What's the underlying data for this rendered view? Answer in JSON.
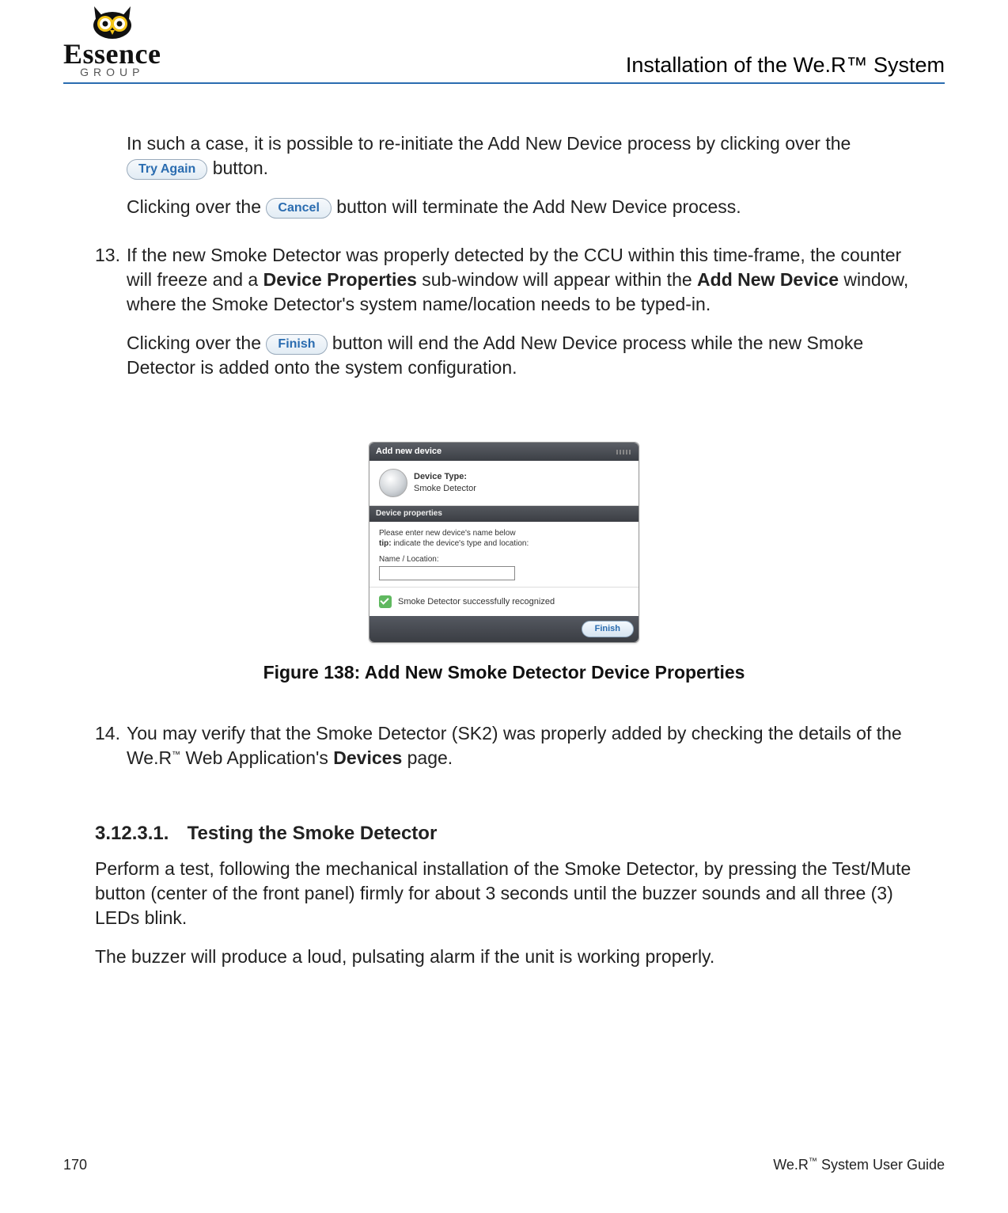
{
  "header": {
    "logo_brand": "Essence",
    "logo_sub": "GROUP",
    "page_title": "Installation of the We.R™ System"
  },
  "buttons": {
    "try_again": "Try Again",
    "cancel": "Cancel",
    "finish": "Finish"
  },
  "body": {
    "intro_line1_a": "In such a case, it is possible to re-initiate the Add New Device process by clicking over the ",
    "intro_line1_b": " button.",
    "intro_line2_a": "Clicking over the ",
    "intro_line2_b": " button will terminate the Add New Device process.",
    "item13_num": "13.",
    "item13_a": "If the new Smoke Detector was properly detected by the CCU within this time-frame, the counter will freeze and a ",
    "item13_b": "Device Properties",
    "item13_c": " sub-window will appear within the ",
    "item13_d": "Add New Device",
    "item13_e": " window, where the Smoke Detector's system name/location needs to be typed-in.",
    "item13_line2_a": "Clicking over the ",
    "item13_line2_b": " button will end the Add New Device process while the new Smoke Detector is added onto the system configuration.",
    "figure_caption": "Figure 138: Add New Smoke Detector Device Properties",
    "item14_num": "14.",
    "item14_a": "You may verify that the Smoke Detector (SK2) was properly added by checking the details of the We.R",
    "item14_tm": "™",
    "item14_b": " Web Application's ",
    "item14_c": "Devices",
    "item14_d": " page.",
    "heading_num": "3.12.3.1.",
    "heading_text": "Testing the Smoke Detector",
    "test_p1": "Perform a test, following the mechanical installation of the Smoke Detector, by pressing the Test/Mute button (center of the front panel) firmly for about 3 seconds until the buzzer sounds and all three (3) LEDs blink.",
    "test_p2": "The buzzer will produce a loud, pulsating alarm if the unit is working properly."
  },
  "mockup": {
    "window_title": "Add new device",
    "device_type_label": "Device Type:",
    "device_type_value": "Smoke Detector",
    "section_title": "Device properties",
    "instr1": "Please enter new device's name below",
    "instr2_prefix": "tip:",
    "instr2": " indicate the device's type and location:",
    "field_label": "Name / Location:",
    "success_text": "Smoke Detector successfully recognized",
    "finish_label": "Finish"
  },
  "footer": {
    "page_num": "170",
    "guide_a": "We.R",
    "guide_tm": "™",
    "guide_b": " System User Guide"
  }
}
